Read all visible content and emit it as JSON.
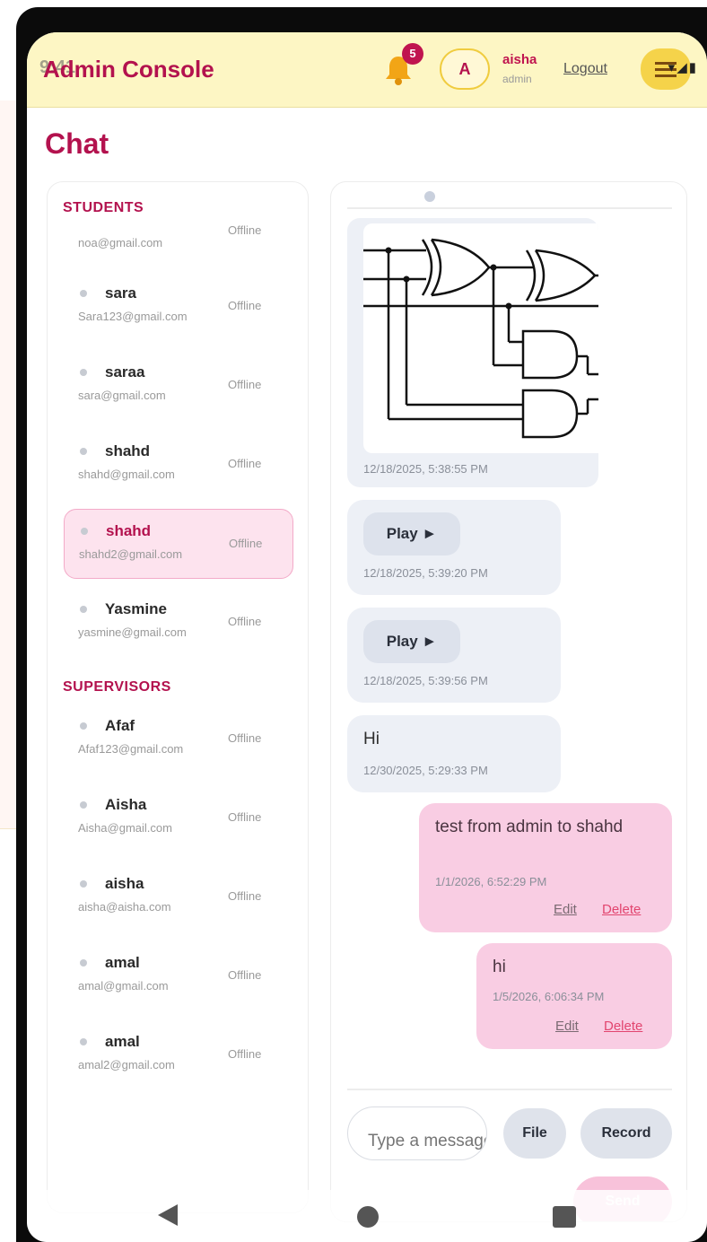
{
  "header": {
    "app_title": "Admin Console",
    "status_time": "9:41",
    "notification_count": "5",
    "avatar_initial": "A",
    "user_name": "aisha",
    "user_role": "admin",
    "logout_label": "Logout"
  },
  "page": {
    "title": "Chat"
  },
  "contacts": {
    "students_label": "STUDENTS",
    "supervisors_label": "SUPERVISORS",
    "students": [
      {
        "name": "",
        "email": "noa@gmail.com",
        "status": "Offline"
      },
      {
        "name": "sara",
        "email": "Sara123@gmail.com",
        "status": "Offline"
      },
      {
        "name": "saraa",
        "email": "sara@gmail.com",
        "status": "Offline"
      },
      {
        "name": "shahd",
        "email": "shahd@gmail.com",
        "status": "Offline"
      },
      {
        "name": "shahd",
        "email": "shahd2@gmail.com",
        "status": "Offline",
        "active": true
      },
      {
        "name": "Yasmine",
        "email": "yasmine@gmail.com",
        "status": "Offline"
      }
    ],
    "supervisors": [
      {
        "name": "Afaf",
        "email": "Afaf123@gmail.com",
        "status": "Offline"
      },
      {
        "name": "Aisha",
        "email": "Aisha@gmail.com",
        "status": "Offline"
      },
      {
        "name": "aisha",
        "email": "aisha@aisha.com",
        "status": "Offline"
      },
      {
        "name": "amal",
        "email": "amal@gmail.com",
        "status": "Offline"
      },
      {
        "name": "amal",
        "email": "amal2@gmail.com",
        "status": "Offline"
      }
    ]
  },
  "messages": [
    {
      "type": "image",
      "direction": "in",
      "time": "12/18/2025, 5:38:55 PM"
    },
    {
      "type": "audio",
      "direction": "in",
      "label": "Play ►",
      "time": "12/18/2025, 5:39:20 PM"
    },
    {
      "type": "audio",
      "direction": "in",
      "label": "Play ►",
      "time": "12/18/2025, 5:39:56 PM"
    },
    {
      "type": "text",
      "direction": "in",
      "text": "Hi",
      "time": "12/30/2025, 5:29:33 PM"
    },
    {
      "type": "text",
      "direction": "out",
      "text": "test from admin to shahd",
      "time": "1/1/2026, 6:52:29 PM",
      "edit": "Edit",
      "delete": "Delete"
    },
    {
      "type": "text",
      "direction": "out",
      "text": "hi",
      "time": "1/5/2026, 6:06:34 PM",
      "edit": "Edit",
      "delete": "Delete"
    }
  ],
  "composer": {
    "placeholder": "Type a message",
    "file_label": "File",
    "record_label": "Record",
    "send_label": "Send"
  },
  "colors": {
    "brand": "#b3124e",
    "header_bg": "#fdf6c4",
    "outgoing_bubble": "#f9cde3",
    "incoming_bubble": "#edf0f6",
    "delete_red": "#e2456f"
  }
}
